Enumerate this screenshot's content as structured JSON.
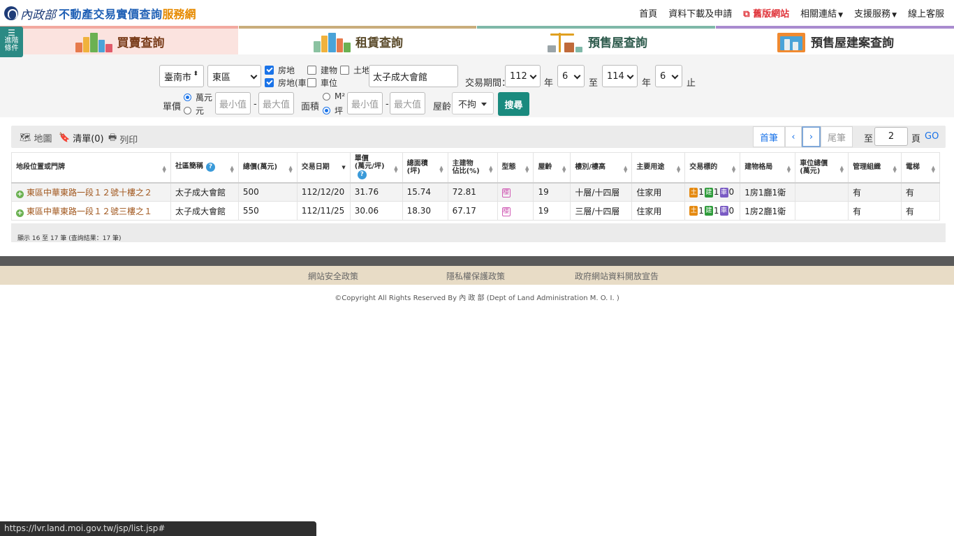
{
  "header": {
    "ministry": "內政部",
    "title_main": "不動產交易實價查詢",
    "title_accent": "服務網",
    "nav": [
      {
        "label": "首頁"
      },
      {
        "label": "資料下載及申請"
      },
      {
        "label": "舊版網站"
      },
      {
        "label": "相關連結"
      },
      {
        "label": "支援服務"
      },
      {
        "label": "線上客服"
      }
    ]
  },
  "adv_button": {
    "line1": "進階",
    "line2": "條件"
  },
  "tabs": [
    {
      "label": "買賣查詢",
      "color": "#f2a9a0"
    },
    {
      "label": "租賃查詢",
      "color": "#c9ad7c"
    },
    {
      "label": "預售屋查詢",
      "color": "#7fb8a8"
    },
    {
      "label": "預售屋建案查詢",
      "color": "#a98bcf"
    }
  ],
  "search": {
    "city": "臺南市",
    "district": "東區",
    "check_land_house": "房地",
    "check_land_house_car": "房地(車)",
    "check_building": "建物",
    "check_parking": "車位",
    "check_land": "土地",
    "keyword": "太子成大會館",
    "period_label": "交易期間：",
    "year_from": "112",
    "month_from": "6",
    "to_label": "至",
    "year_to": "114",
    "month_to": "6",
    "year_unit": "年",
    "end_label": "止",
    "unit_price_label": "單價",
    "unit_wan": "萬元",
    "unit_yuan": "元",
    "min_placeholder": "最小值",
    "max_placeholder": "最大值",
    "dash": "-",
    "area_label": "面積",
    "area_m2": "M²",
    "area_ping": "坪",
    "age_label": "屋齡",
    "age_value": "不拘",
    "search_button": "搜尋"
  },
  "toolbar": {
    "map": "地圖",
    "list": "清單(0)",
    "print": "列印",
    "first": "首筆",
    "prev": "‹",
    "next": "›",
    "last": "尾筆",
    "goto_label": "至",
    "page_value": "2",
    "page_unit": "頁",
    "go": "GO"
  },
  "table": {
    "headers": [
      "地段位置或門牌",
      "社區簡稱",
      "總價(萬元)",
      "交易日期",
      "單價\n(萬元/坪)",
      "總面積\n(坪)",
      "主建物\n佔比(%)",
      "型態",
      "屋齡",
      "樓別/樓高",
      "主要用途",
      "交易標的",
      "建物格局",
      "車位總價\n(萬元)",
      "管理組織",
      "電梯"
    ],
    "rows": [
      {
        "address": "東區中華東路一段１２號十樓之２",
        "community": "太子成大會館",
        "total": "500",
        "date": "112/12/20",
        "unit_price": "31.76",
        "area": "15.74",
        "main_ratio": "72.81",
        "type_tag": "樓",
        "age": "19",
        "floor": "十層/十四層",
        "usage": "住家用",
        "tgt_land": "1",
        "tgt_build": "1",
        "tgt_car": "0",
        "layout": "1房1廳1衛",
        "car_price": "",
        "mgmt": "有",
        "elevator": "有"
      },
      {
        "address": "東區中華東路一段１２號三樓之１",
        "community": "太子成大會館",
        "total": "550",
        "date": "112/11/25",
        "unit_price": "30.06",
        "area": "18.30",
        "main_ratio": "67.17",
        "type_tag": "樓",
        "age": "19",
        "floor": "三層/十四層",
        "usage": "住家用",
        "tgt_land": "1",
        "tgt_build": "1",
        "tgt_car": "0",
        "layout": "1房2廳1衛",
        "car_price": "",
        "mgmt": "有",
        "elevator": "有"
      }
    ],
    "target_tags": {
      "land": "土",
      "build": "建",
      "car": "車"
    }
  },
  "summary": "顯示 16 至 17 筆 (查詢結果：17 筆)",
  "footer": {
    "links": [
      "網站安全政策",
      "隱私權保護政策",
      "政府網站資料開放宣告"
    ],
    "copyright": "©Copyright All Rights Reserved By 內 政 部 (Dept of Land Administration M. O. I. )"
  },
  "status_url": "https://lvr.land.moi.gov.tw/jsp/list.jsp#"
}
